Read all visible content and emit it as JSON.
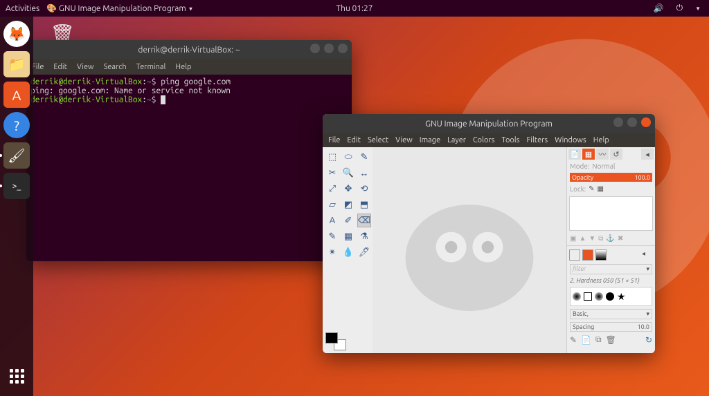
{
  "topbar": {
    "activities": "Activities",
    "app_indicator": "GNU Image Manipulation Program",
    "clock": "Thu 01:27"
  },
  "dock": {
    "items": [
      {
        "name": "firefox",
        "glyph": "🦊"
      },
      {
        "name": "files",
        "glyph": "🗄"
      },
      {
        "name": "software",
        "glyph": "🛍"
      },
      {
        "name": "help",
        "glyph": "?"
      },
      {
        "name": "gimp",
        "glyph": "🎨"
      },
      {
        "name": "terminal",
        "glyph": ">_"
      }
    ]
  },
  "desktop": {
    "trash_label": ""
  },
  "terminal": {
    "title": "derrik@derrik-VirtualBox: ~",
    "menu": [
      "File",
      "Edit",
      "View",
      "Search",
      "Terminal",
      "Help"
    ],
    "lines": [
      {
        "user": "derrik@derrik-VirtualBox",
        "path": "~",
        "cmd": "ping google.com"
      },
      {
        "plain": "ping: google.com: Name or service not known"
      },
      {
        "user": "derrik@derrik-VirtualBox",
        "path": "~",
        "cmd": ""
      }
    ]
  },
  "gimp": {
    "title": "GNU Image Manipulation Program",
    "menu": [
      "File",
      "Edit",
      "Select",
      "View",
      "Image",
      "Layer",
      "Colors",
      "Tools",
      "Filters",
      "Windows",
      "Help"
    ],
    "tools": [
      "⬚",
      "⬭",
      "✎",
      "✂",
      "🔍",
      "↔",
      "⤢",
      "✥",
      "⟲",
      "▱",
      "◩",
      "⬒",
      "A",
      "✐",
      "⌫",
      "✎",
      "▦",
      "⚗",
      "✴",
      "💧",
      "🖊"
    ],
    "right": {
      "mode_label": "Mode:",
      "mode_value": "Normal",
      "opacity_label": "Opacity",
      "opacity_value": "100.0",
      "lock_label": "Lock:",
      "filter_placeholder": "filter",
      "brush_name": "2. Hardness 050 (51 × 51)",
      "basic_label": "Basic,",
      "spacing_label": "Spacing",
      "spacing_value": "10.0"
    }
  }
}
